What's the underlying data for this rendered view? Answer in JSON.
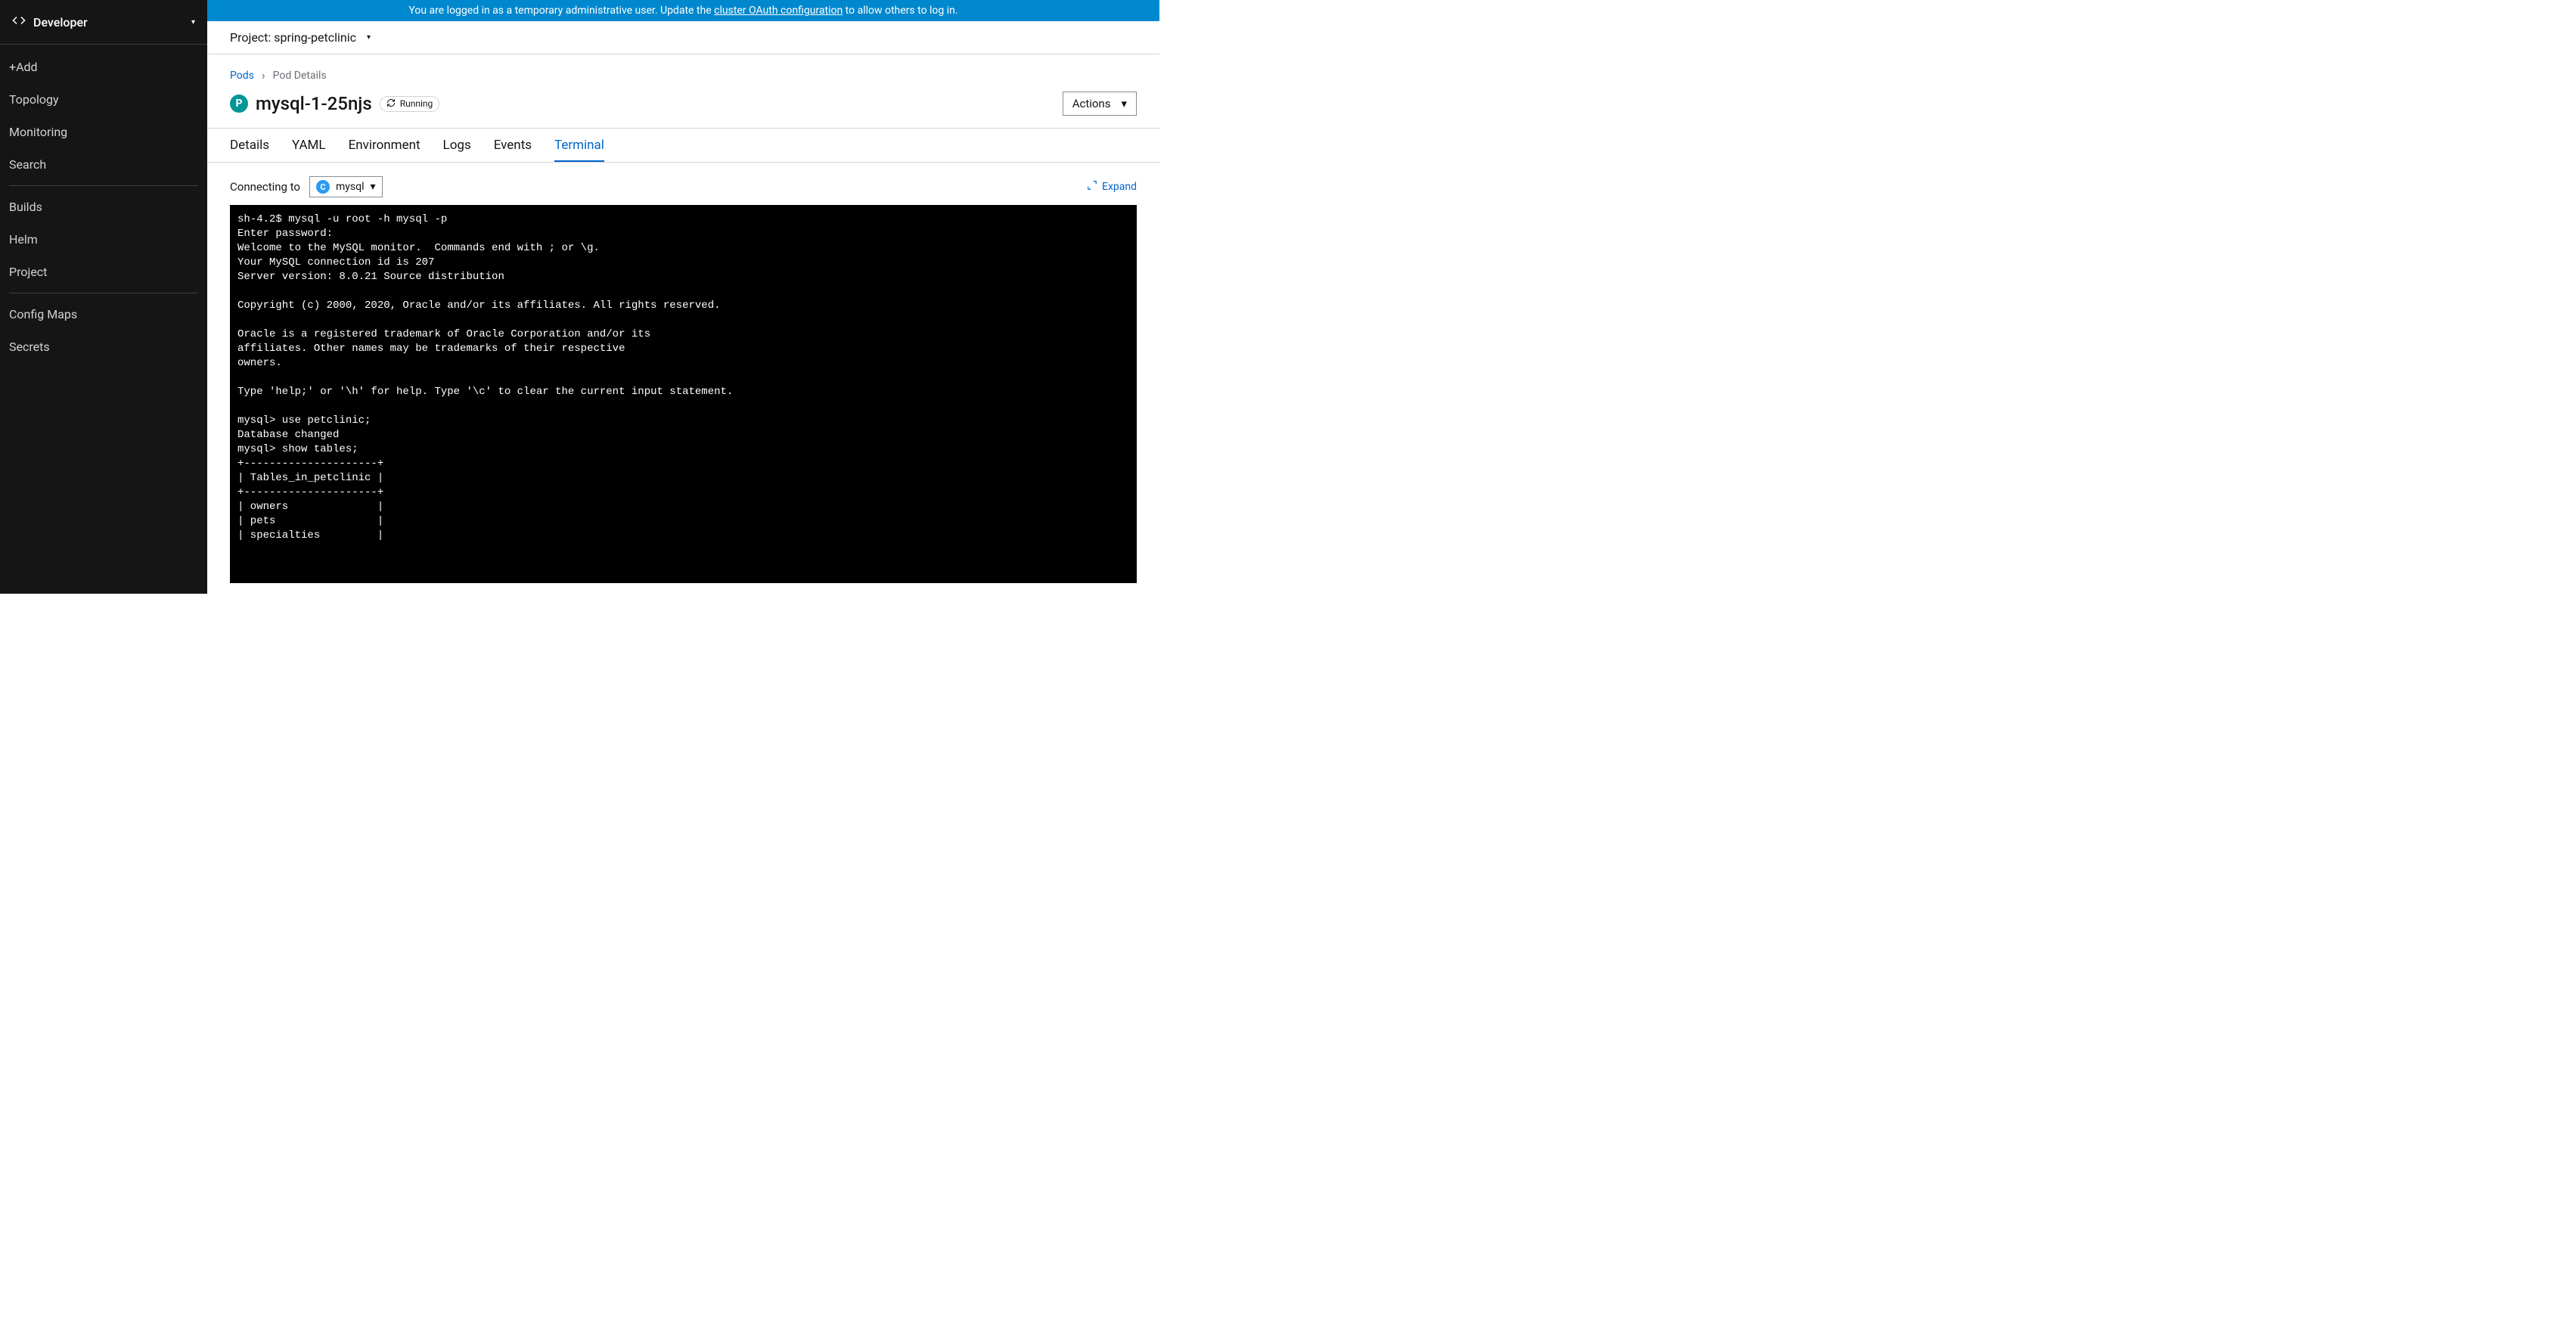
{
  "sidebar": {
    "perspective": "Developer",
    "items": [
      "+Add",
      "Topology",
      "Monitoring",
      "Search",
      "Builds",
      "Helm",
      "Project",
      "Config Maps",
      "Secrets"
    ],
    "dividers_after": [
      3,
      6
    ]
  },
  "banner": {
    "text_pre": "You are logged in as a temporary administrative user. Update the ",
    "link": "cluster OAuth configuration",
    "text_post": " to allow others to log in."
  },
  "project": {
    "label": "Project: spring-petclinic"
  },
  "breadcrumb": {
    "root": "Pods",
    "current": "Pod Details"
  },
  "pod": {
    "badge": "P",
    "name": "mysql-1-25njs",
    "status": "Running"
  },
  "actions_label": "Actions",
  "tabs": [
    "Details",
    "YAML",
    "Environment",
    "Logs",
    "Events",
    "Terminal"
  ],
  "active_tab": "Terminal",
  "terminal_bar": {
    "connecting_label": "Connecting to",
    "container_badge": "C",
    "container_name": "mysql",
    "expand_label": "Expand"
  },
  "terminal_output": "sh-4.2$ mysql -u root -h mysql -p\nEnter password:\nWelcome to the MySQL monitor.  Commands end with ; or \\g.\nYour MySQL connection id is 207\nServer version: 8.0.21 Source distribution\n\nCopyright (c) 2000, 2020, Oracle and/or its affiliates. All rights reserved.\n\nOracle is a registered trademark of Oracle Corporation and/or its\naffiliates. Other names may be trademarks of their respective\nowners.\n\nType 'help;' or '\\h' for help. Type '\\c' to clear the current input statement.\n\nmysql> use petclinic;\nDatabase changed\nmysql> show tables;\n+---------------------+\n| Tables_in_petclinic |\n+---------------------+\n| owners              |\n| pets                |\n| specialties         |"
}
